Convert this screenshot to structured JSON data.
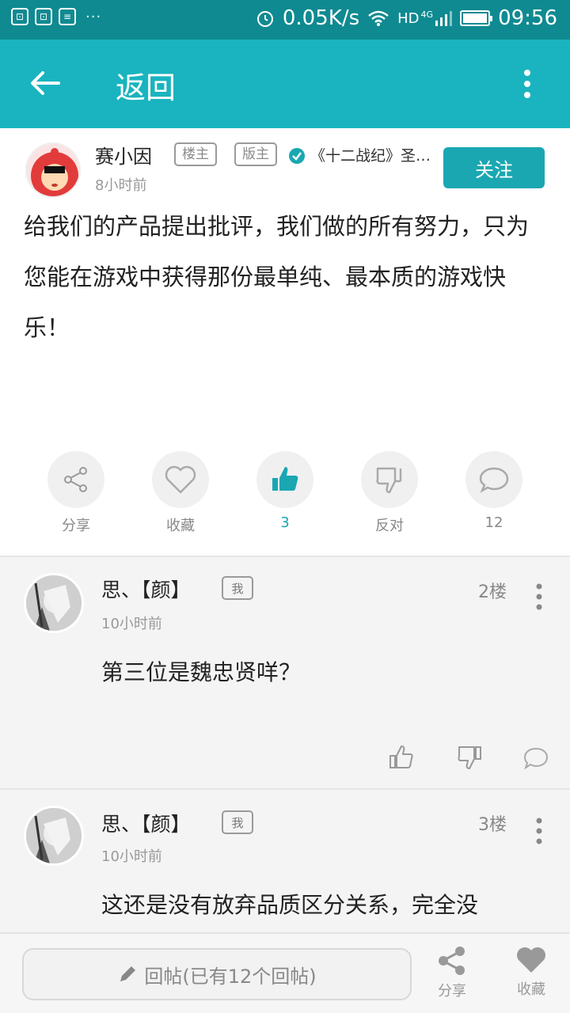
{
  "status_bar": {
    "left_icons": [
      "notification-icon",
      "notification-icon",
      "message-icon"
    ],
    "more": "···",
    "network_speed": "0.05K/s",
    "network_type": "HD",
    "signal_label": "4G",
    "time": "09:56"
  },
  "header": {
    "back_label": "返回"
  },
  "post": {
    "author": "赛小因",
    "tag_owner": "楼主",
    "tag_mod": "版主",
    "game": "《十二战纪》圣…",
    "time": "8小时前",
    "follow_label": "关注",
    "body": "给我们的产品提出批评，我们做的所有努力，只为您能在游戏中获得那份最单纯、最本质的游戏快乐！"
  },
  "actions": {
    "share_label": "分享",
    "favorite_label": "收藏",
    "like_count": "3",
    "dislike_label": "反对",
    "comment_count": "12"
  },
  "replies": [
    {
      "name": "思、【颜】",
      "me_tag": "我",
      "floor": "2楼",
      "time": "10小时前",
      "text": "第三位是魏忠贤咩？"
    },
    {
      "name": "思、【颜】",
      "me_tag": "我",
      "floor": "3楼",
      "time": "10小时前",
      "text": "这还是没有放弃品质区分关系，完全没"
    }
  ],
  "bottom_bar": {
    "reply_placeholder": "回帖(已有12个回帖)",
    "share_label": "分享",
    "favorite_label": "收藏"
  },
  "colors": {
    "accent": "#19b4bf",
    "status_bar": "#0f8a91",
    "follow_button": "#1aa7b2"
  }
}
